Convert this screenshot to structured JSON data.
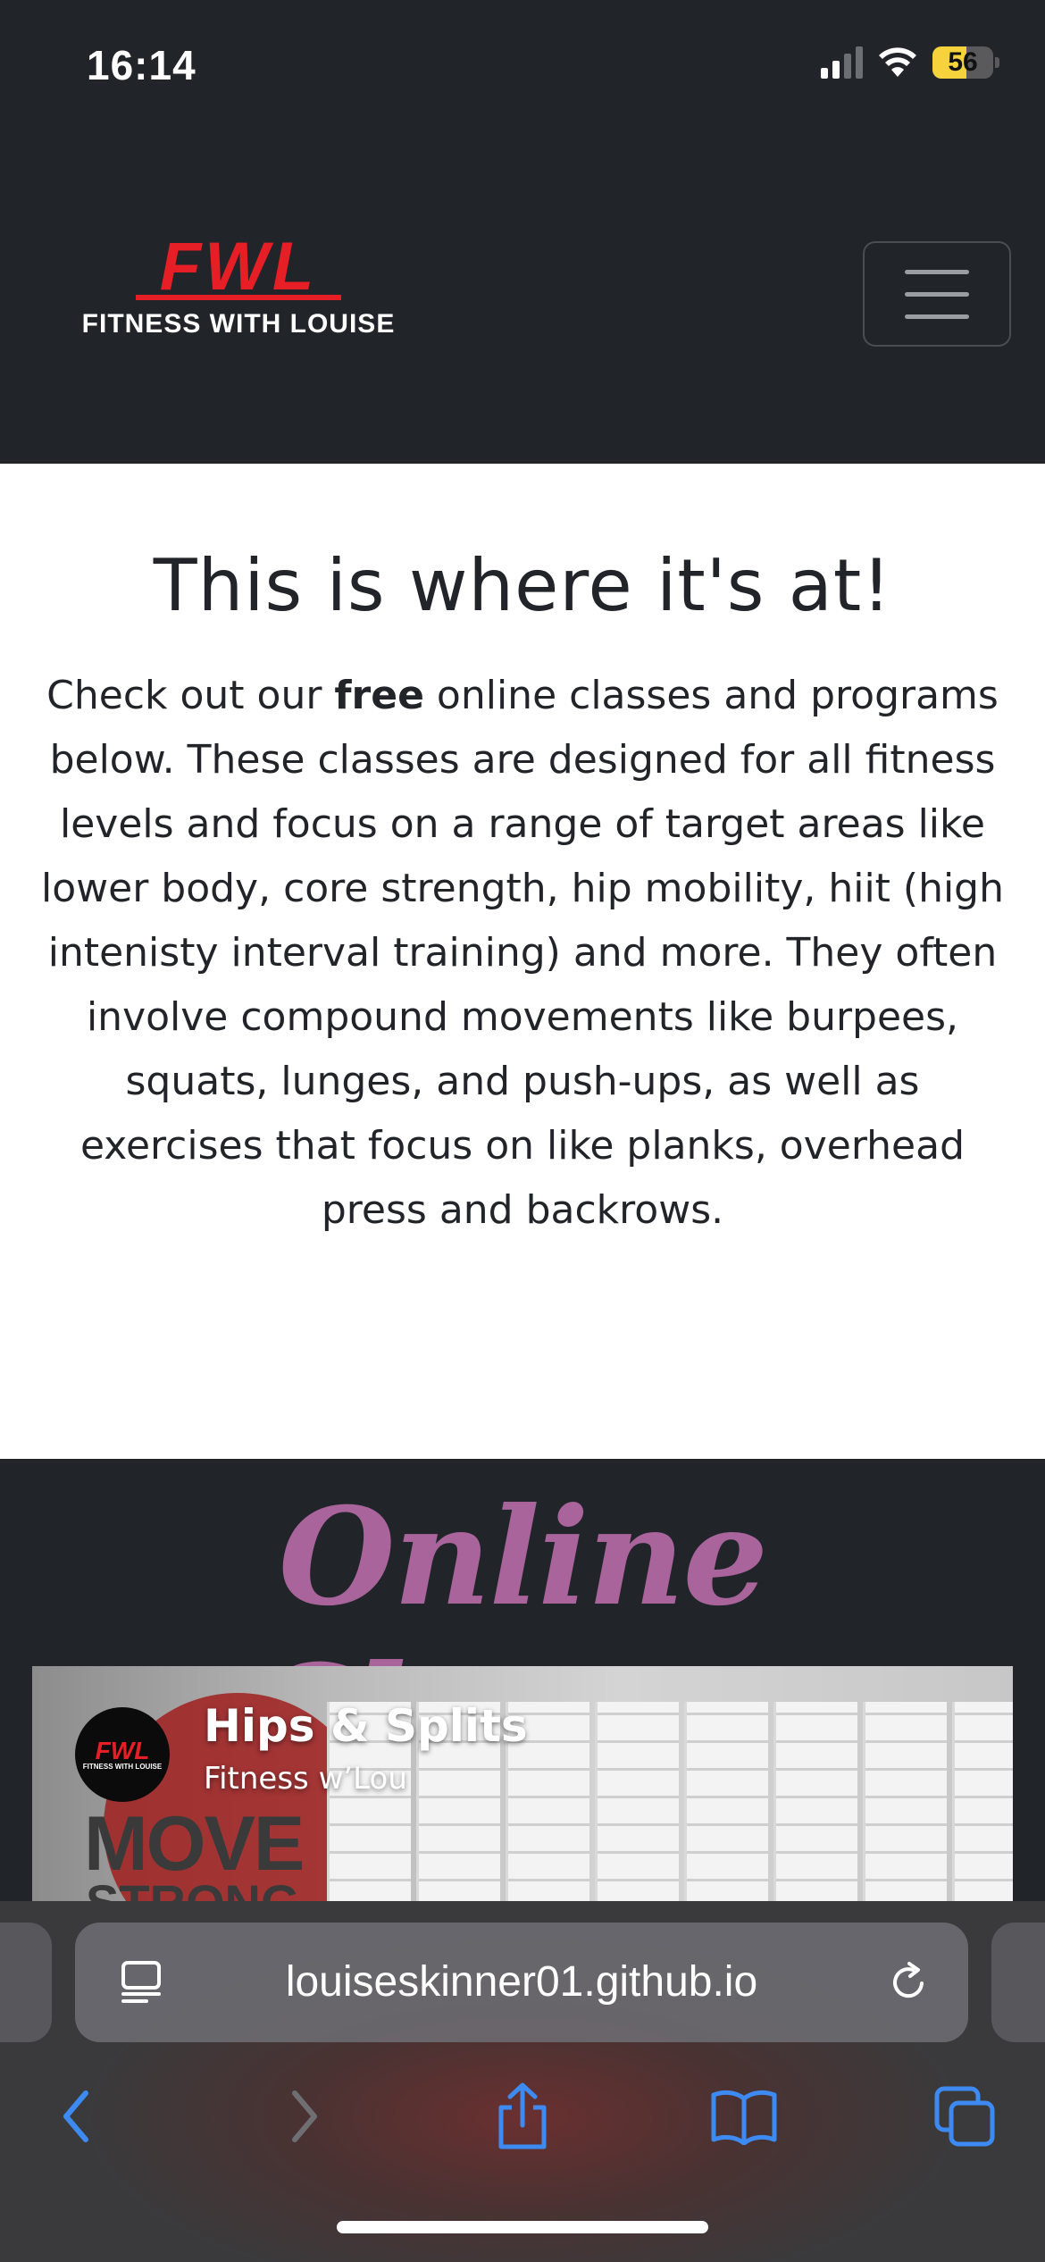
{
  "status_bar": {
    "time": "16:14",
    "battery": "56"
  },
  "navbar": {
    "logo_mark": "FWL",
    "logo_sub": "FITNESS WITH LOUISE"
  },
  "intro": {
    "heading": "This is where it's at!",
    "text_before": "Check out our ",
    "text_bold": "free",
    "text_after": " online classes and programs below. These classes are designed for all fitness levels and focus on a range of target areas like lower body, core strength, hip mobility, hiit (high intenisty interval training) and more. They often involve compound movements like burpees, squats, lunges, and push-ups, as well as exercises that focus on like planks, overhead press and backrows."
  },
  "classes": {
    "title": "Online Classes",
    "video": {
      "title": "Hips & Splits",
      "channel": "Fitness w’Lou",
      "thumb_text_1": "MOVE",
      "thumb_text_2": "STRONG",
      "avatar_mark": "FWL",
      "avatar_sub": "FITNESS WITH LOUISE"
    }
  },
  "browser": {
    "url": "louiseskinner01.github.io",
    "accent": "#3d8bf2"
  }
}
